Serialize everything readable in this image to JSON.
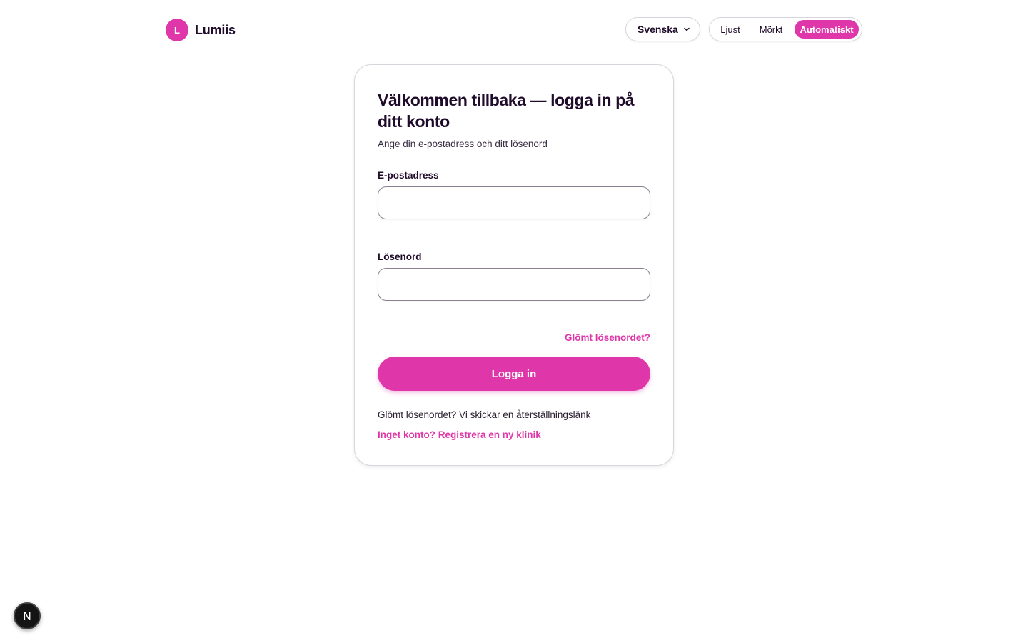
{
  "brand": {
    "logo_letter": "L",
    "name": "Lumiis",
    "accent": "#df37a9"
  },
  "header": {
    "language": {
      "selected": "Svenska",
      "icon": "chevron-down-icon"
    },
    "theme": {
      "options": [
        "Ljust",
        "Mörkt",
        "Automatiskt"
      ],
      "selected": "Automatiskt"
    }
  },
  "login": {
    "title": "Välkommen tillbaka — logga in på ditt konto",
    "subtitle": "Ange din e-postadress och ditt lösenord",
    "email_label": "E-postadress",
    "email_value": "",
    "password_label": "Lösenord",
    "password_value": "",
    "forgot_link": "Glömt lösenordet?",
    "submit_label": "Logga in",
    "help_text": "Glömt lösenordet? Vi skickar en återställningslänk",
    "register_link": "Inget konto? Registrera en ny klinik"
  },
  "dev_badge": {
    "letter": "N"
  }
}
